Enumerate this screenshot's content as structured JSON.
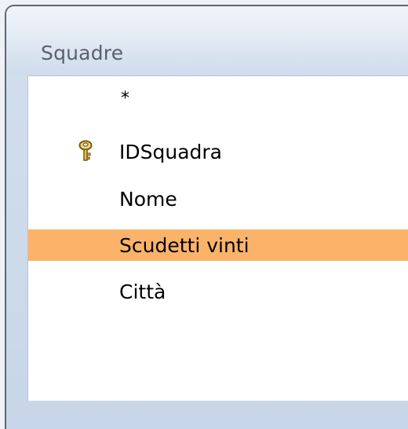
{
  "window": {
    "title": "Squadre"
  },
  "fields": [
    {
      "label": "*",
      "primary_key": false,
      "selected": false
    },
    {
      "label": "IDSquadra",
      "primary_key": true,
      "selected": false,
      "icon": "key-icon"
    },
    {
      "label": "Nome",
      "primary_key": false,
      "selected": false
    },
    {
      "label": "Scudetti vinti",
      "primary_key": false,
      "selected": true
    },
    {
      "label": "Città",
      "primary_key": false,
      "selected": false
    }
  ],
  "colors": {
    "selection": "#fbb36a",
    "title_text": "#59606b",
    "list_background": "#ffffff"
  }
}
